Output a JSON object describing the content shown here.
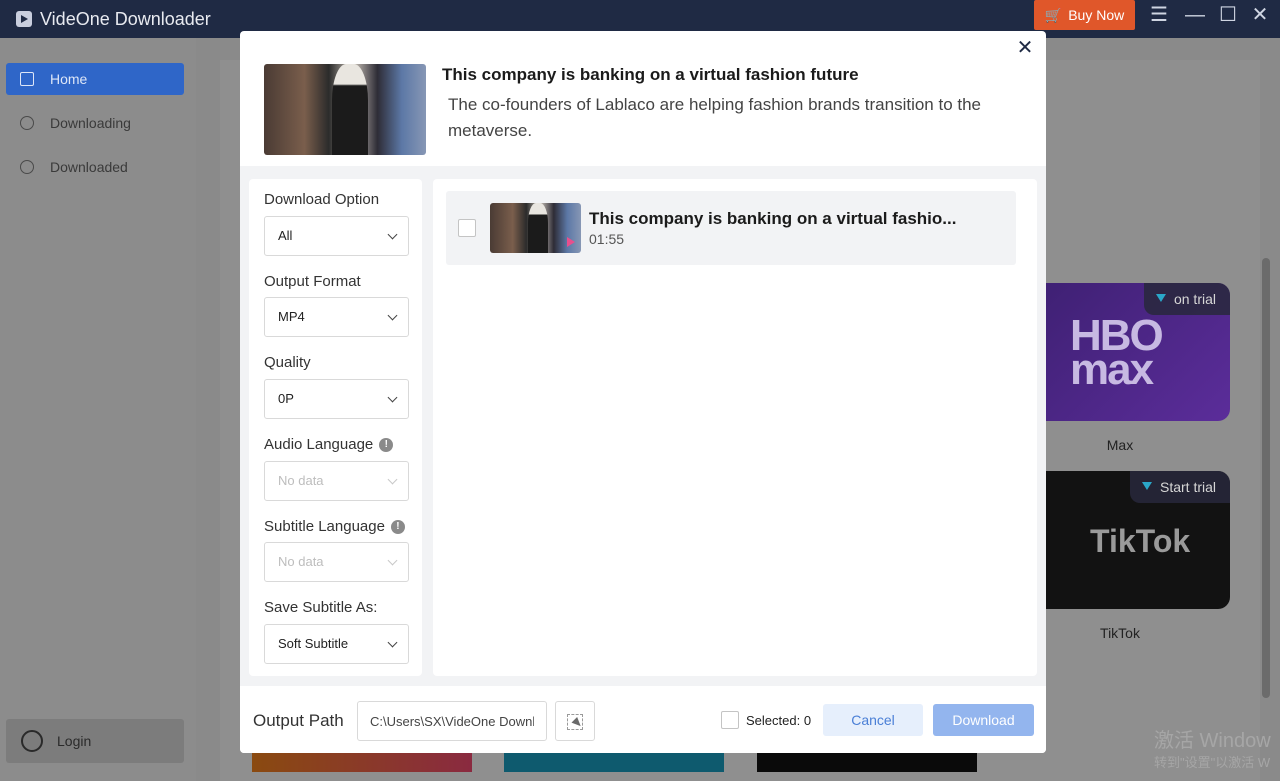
{
  "app": {
    "title": "VideOne Downloader",
    "buy_label": "Buy Now",
    "cart_icon": "🛒"
  },
  "sidebar": {
    "items": [
      {
        "label": "Home",
        "icon": "home-icon"
      },
      {
        "label": "Downloading",
        "icon": "cloud-download-icon"
      },
      {
        "label": "Downloaded",
        "icon": "check-circle-icon"
      }
    ],
    "login_label": "Login"
  },
  "services": [
    {
      "name": "Max",
      "badge": "on trial",
      "logo_text": "HBO max"
    },
    {
      "name": "TikTok",
      "badge": "Start trial",
      "logo_text": "TikTok"
    }
  ],
  "watermark": {
    "line1": "激活 Window",
    "line2": "转到\"设置\"以激活 W"
  },
  "modal": {
    "title": "This company is banking on a virtual fashion future",
    "description": "The co-founders of Lablaco are helping fashion brands transition to the metaverse.",
    "options": {
      "download_option": {
        "label": "Download Option",
        "value": "All"
      },
      "output_format": {
        "label": "Output Format",
        "value": "MP4"
      },
      "quality": {
        "label": "Quality",
        "value": "0P"
      },
      "audio_language": {
        "label": "Audio Language",
        "value": "No data"
      },
      "subtitle_language": {
        "label": "Subtitle Language",
        "value": "No data"
      },
      "save_subtitle_as": {
        "label": "Save Subtitle As:",
        "value": "Soft Subtitle"
      }
    },
    "videos": [
      {
        "title": "This company is banking on a virtual fashio...",
        "duration": "01:55"
      }
    ],
    "footer": {
      "output_path_label": "Output Path",
      "output_path_value": "C:\\Users\\SX\\VideOne Downloader",
      "selected_text": "Selected: 0",
      "cancel_label": "Cancel",
      "download_label": "Download"
    }
  }
}
